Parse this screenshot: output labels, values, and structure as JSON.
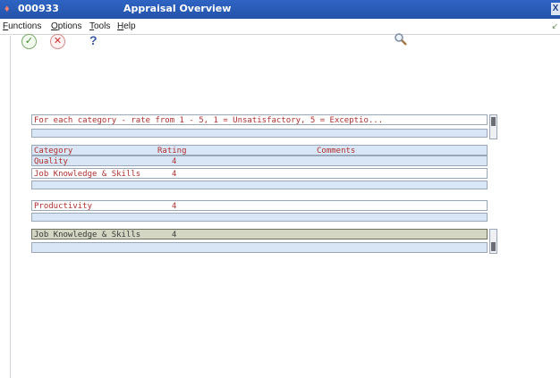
{
  "titlebar": {
    "form_id": "000933",
    "title": "Appraisal Overview",
    "close_glyph": "X"
  },
  "menu": {
    "items": [
      {
        "label": "Functions",
        "accel": "F"
      },
      {
        "label": "Options",
        "accel": "O"
      },
      {
        "label": "Tools",
        "accel": "T"
      },
      {
        "label": "Help",
        "accel": "H"
      }
    ]
  },
  "toolbar": {
    "ok_icon": "checkmark-icon",
    "cancel_icon": "x-icon",
    "help_glyph": "?",
    "find_icon": "magnifier-icon"
  },
  "grid": {
    "instructions": "For each category - rate from 1 - 5, 1 = Unsatisfactory, 5 = Exceptio...",
    "headers": {
      "category": "Category",
      "rating": "Rating",
      "comments": "Comments"
    },
    "rows": [
      {
        "category": "Quality",
        "rating": "4"
      },
      {
        "category": "Job Knowledge & Skills",
        "rating": "4"
      },
      {
        "category": "",
        "rating": ""
      },
      {
        "category": "Productivity",
        "rating": "4"
      },
      {
        "category": "",
        "rating": ""
      },
      {
        "category": "Job Knowledge & Skills",
        "rating": "4"
      },
      {
        "category": "",
        "rating": ""
      }
    ],
    "selected_row": 5
  }
}
